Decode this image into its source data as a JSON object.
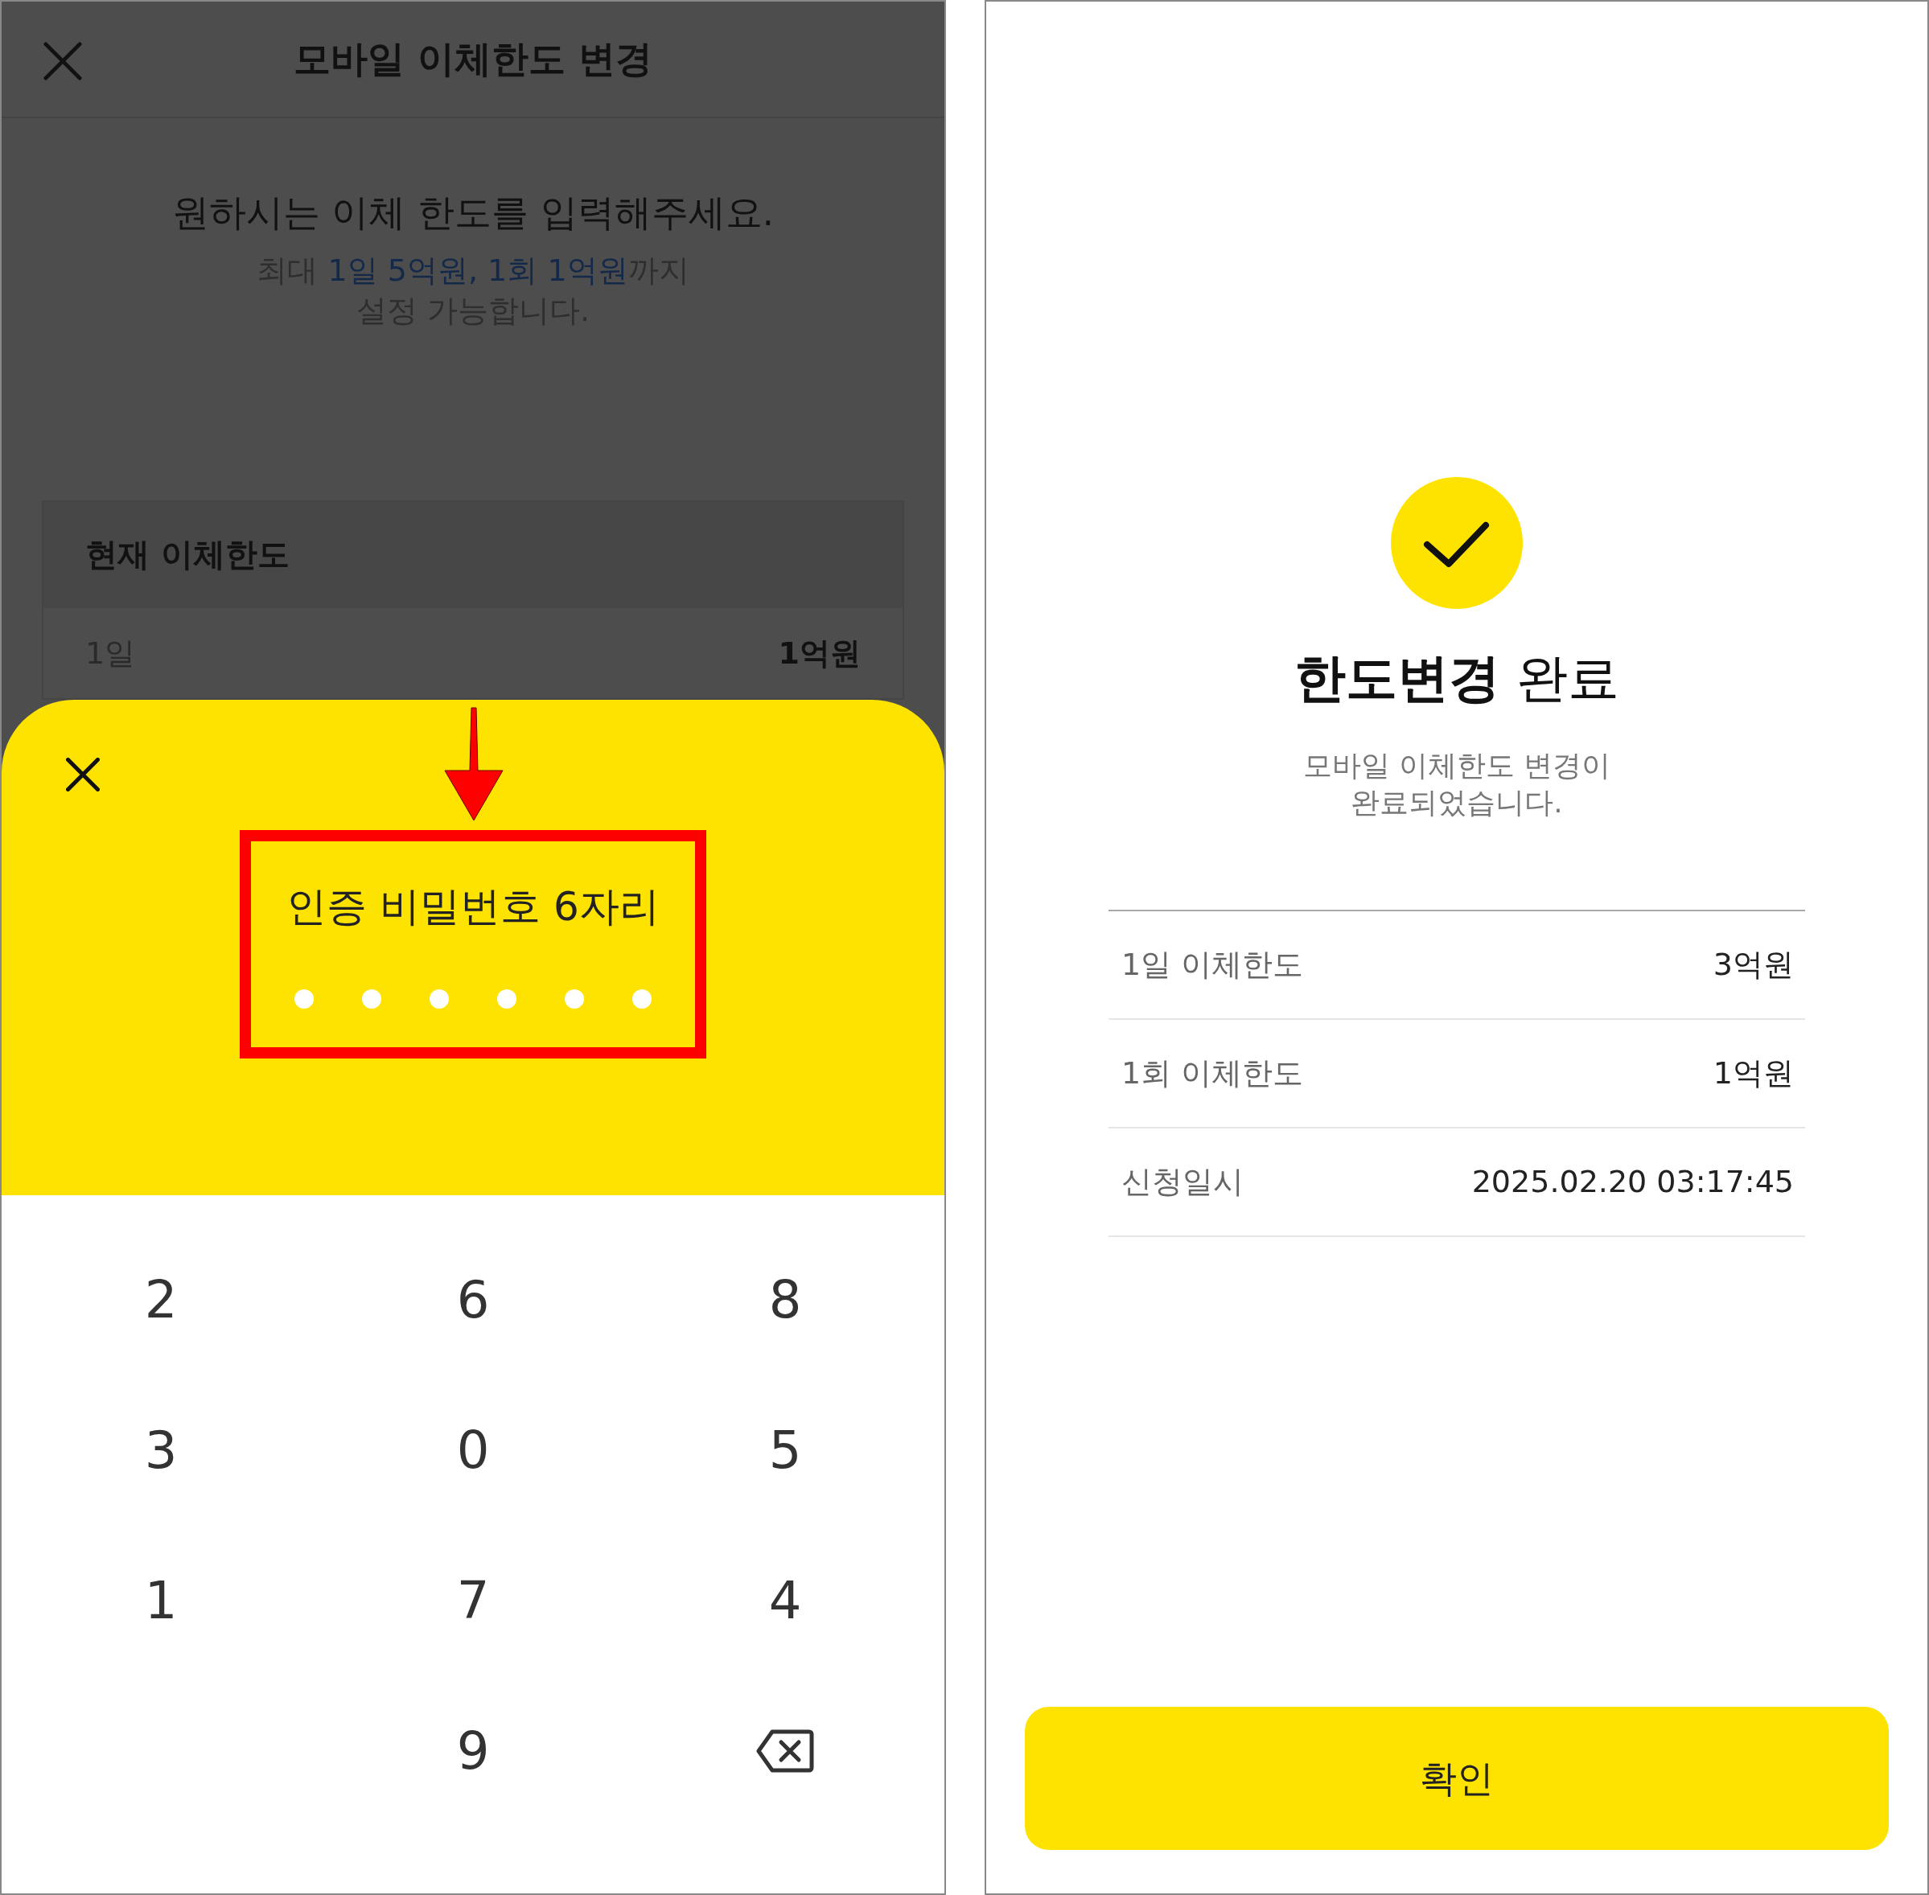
{
  "left_screen": {
    "header": {
      "title": "모바일 이체한도 변경"
    },
    "intro": {
      "heading": "원하시는 이체 한도를 입력해주세요.",
      "note_before": "최대 ",
      "note_highlight": "1일 5억원, 1회 1억원",
      "note_after": "까지",
      "note_line2": "설정 가능합니다."
    },
    "current_limit": {
      "title": "현재 이체한도",
      "rows": [
        {
          "label": "1일",
          "value": "1억원"
        }
      ]
    },
    "pin_sheet": {
      "prompt": "인증 비밀번호 6자리",
      "dots": [
        {
          "filled": false
        },
        {
          "filled": false
        },
        {
          "filled": false
        },
        {
          "filled": false
        },
        {
          "filled": false
        },
        {
          "filled": false
        }
      ]
    },
    "keypad": [
      {
        "kind": "digit",
        "label": "2"
      },
      {
        "kind": "digit",
        "label": "6"
      },
      {
        "kind": "digit",
        "label": "8"
      },
      {
        "kind": "digit",
        "label": "3"
      },
      {
        "kind": "digit",
        "label": "0"
      },
      {
        "kind": "digit",
        "label": "5"
      },
      {
        "kind": "digit",
        "label": "1"
      },
      {
        "kind": "digit",
        "label": "7"
      },
      {
        "kind": "digit",
        "label": "4"
      },
      {
        "kind": "blank"
      },
      {
        "kind": "digit",
        "label": "9"
      },
      {
        "kind": "backspace"
      }
    ]
  },
  "right_screen": {
    "title": "**한도변경** 완료",
    "message_line1": "모바일 이체한도 변경이",
    "message_line2": "완료되었습니다.",
    "details": [
      {
        "label": "1일 이체한도",
        "value": "3억원"
      },
      {
        "label": "1회 이체한도",
        "value": "1억원"
      },
      {
        "label": "신청일시",
        "value": "2025.02.20 03:17:45"
      }
    ],
    "confirm_button": "확인"
  }
}
